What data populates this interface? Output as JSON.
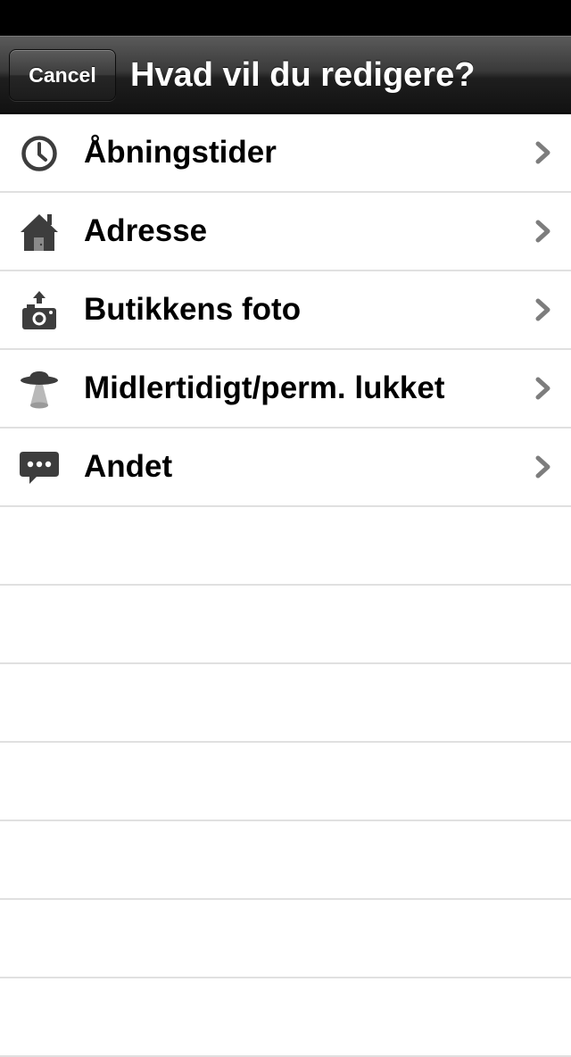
{
  "nav": {
    "cancel_label": "Cancel",
    "title": "Hvad vil du redigere?"
  },
  "rows": [
    {
      "label": "Åbningstider",
      "icon": "clock-icon"
    },
    {
      "label": "Adresse",
      "icon": "house-icon"
    },
    {
      "label": "Butikkens foto",
      "icon": "camera-upload-icon"
    },
    {
      "label": "Midlertidigt/perm. lukket",
      "icon": "ufo-icon"
    },
    {
      "label": "Andet",
      "icon": "speech-bubble-icon"
    }
  ],
  "colors": {
    "nav_bg": "#2a2a2a",
    "icon": "#3d3d3d",
    "chevron": "#7d7d7d",
    "separator": "#e0e0e0"
  }
}
